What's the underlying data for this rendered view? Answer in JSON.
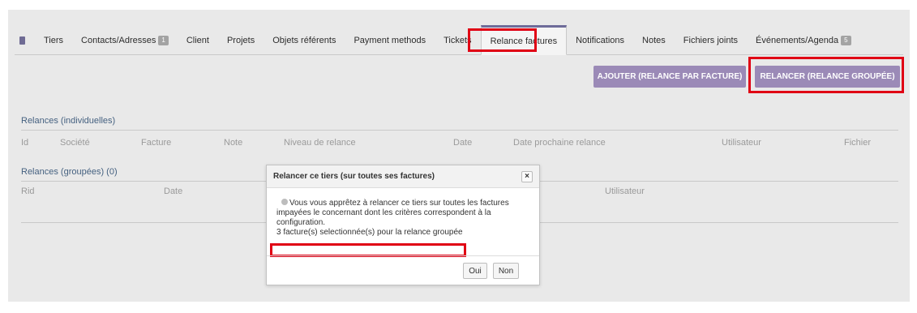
{
  "tabs": [
    {
      "label": "",
      "icon": "building-icon"
    },
    {
      "label": "Tiers"
    },
    {
      "label": "Contacts/Adresses",
      "badge": "1"
    },
    {
      "label": "Client"
    },
    {
      "label": "Projets"
    },
    {
      "label": "Objets référents"
    },
    {
      "label": "Payment methods"
    },
    {
      "label": "Tickets"
    },
    {
      "label": "Relance factures",
      "active": true
    },
    {
      "label": "Notifications"
    },
    {
      "label": "Notes"
    },
    {
      "label": "Fichiers joints"
    },
    {
      "label": "Événements/Agenda",
      "badge": "5"
    }
  ],
  "actions": {
    "add_label": "AJOUTER (RELANCE PAR FACTURE)",
    "group_label": "RELANCER (RELANCE GROUPÉE)"
  },
  "individual": {
    "title": "Relances (individuelles)",
    "columns": [
      "Id",
      "Société",
      "Facture",
      "Note",
      "Niveau de relance",
      "Date",
      "Date prochaine relance",
      "Utilisateur",
      "Fichier"
    ]
  },
  "grouped": {
    "title": "Relances (groupées) (0)",
    "columns": [
      "Rid",
      "Date",
      "Utilisateur"
    ]
  },
  "modal": {
    "title": "Relancer ce tiers (sur toutes ses factures)",
    "close": "×",
    "info": "Vous vous apprêtez à relancer ce tiers sur toutes les factures impayées le concernant dont les critères correspondent à la configuration.",
    "selected": "3 facture(s) selectionnée(s) pour la relance groupée",
    "yes": "Oui",
    "no": "Non"
  },
  "colors": {
    "accent": "#9b8ab7",
    "highlight": "#e00014",
    "section_title": "#456180"
  }
}
